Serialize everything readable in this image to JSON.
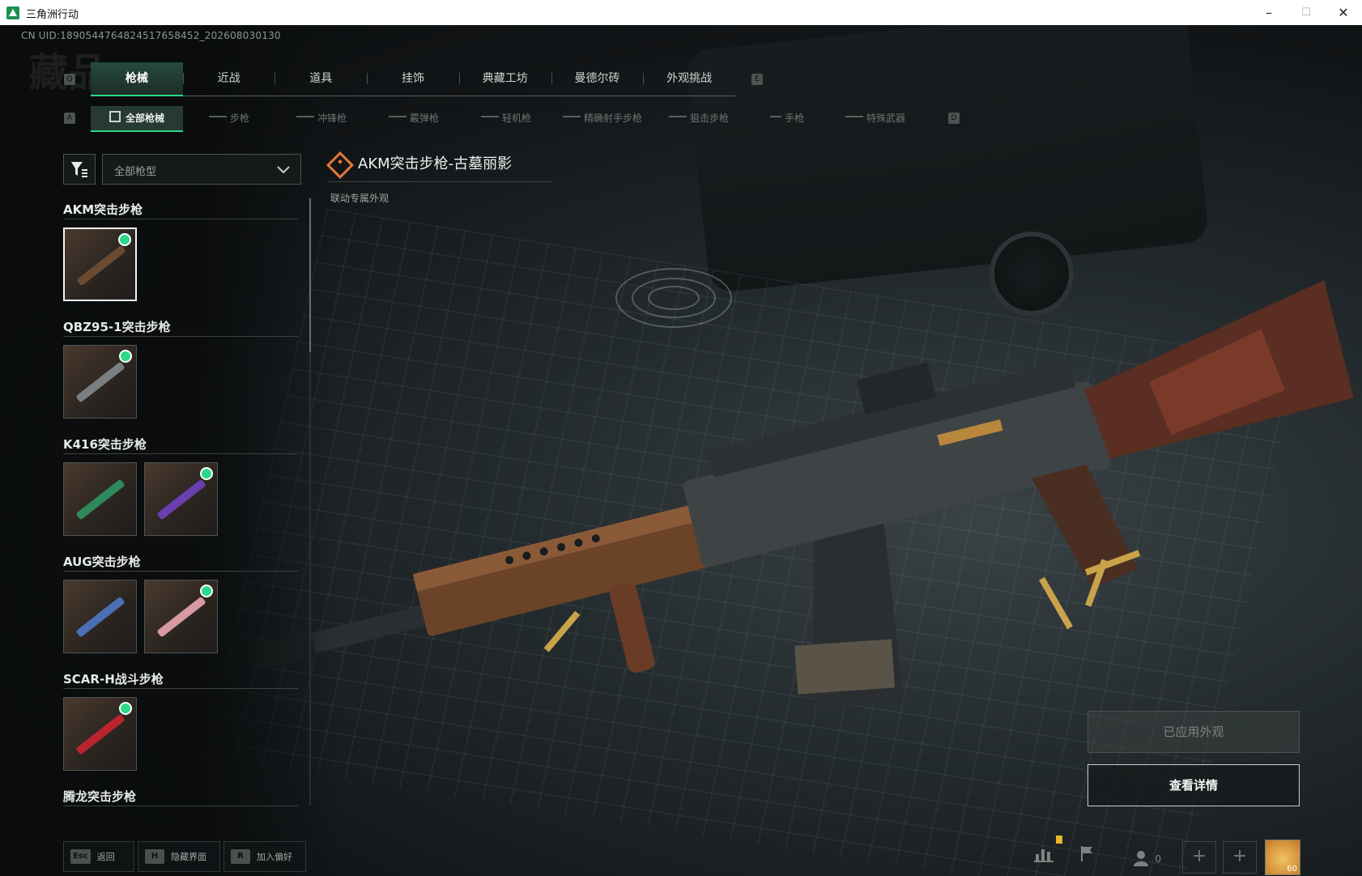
{
  "window": {
    "title": "三角洲行动",
    "minimize": "–",
    "maximize": "☐",
    "close": "✕"
  },
  "uid": "CN UID:1890544764824517658452_202608030130",
  "watermark": "藏品",
  "main_tabs": {
    "left_key": "Q",
    "right_key": "E",
    "items": [
      "枪械",
      "近战",
      "道具",
      "挂饰",
      "典藏工坊",
      "曼德尔砖",
      "外观挑战"
    ],
    "active_index": 0
  },
  "sub_tabs": {
    "left_key": "A",
    "right_key": "D",
    "items": [
      "全部枪械",
      "步枪",
      "冲锋枪",
      "霰弹枪",
      "轻机枪",
      "精确射手步枪",
      "狙击步枪",
      "手枪",
      "特殊武器"
    ],
    "active_index": 0
  },
  "filter": {
    "dropdown_value": "全部枪型"
  },
  "categories": [
    {
      "title": "AKM突击步枪",
      "skins": [
        {
          "color": "#6b4a30",
          "equipped": true,
          "selected": true
        }
      ]
    },
    {
      "title": "QBZ95-1突击步枪",
      "skins": [
        {
          "color": "#7a7f82",
          "equipped": true,
          "selected": false
        }
      ]
    },
    {
      "title": "K416突击步枪",
      "skins": [
        {
          "color": "#2e8a5a",
          "equipped": false,
          "selected": false
        },
        {
          "color": "#6a3fb0",
          "equipped": true,
          "selected": false
        }
      ]
    },
    {
      "title": "AUG突击步枪",
      "skins": [
        {
          "color": "#4a6fb5",
          "equipped": false,
          "selected": false
        },
        {
          "color": "#d79aa0",
          "equipped": true,
          "selected": false
        }
      ]
    },
    {
      "title": "SCAR-H战斗步枪",
      "skins": [
        {
          "color": "#b8242d",
          "equipped": true,
          "selected": false
        }
      ]
    },
    {
      "title": "腾龙突击步枪",
      "skins": []
    }
  ],
  "item": {
    "name": "AKM突击步枪-古墓丽影",
    "tag": "联动专属外观",
    "accent": "#e4783a"
  },
  "buttons": {
    "applied": "已应用外观",
    "detail": "查看详情"
  },
  "bottom_hints": [
    {
      "key": "Esc",
      "label": "返回"
    },
    {
      "key": "H",
      "label": "隐藏界面"
    },
    {
      "key": "R",
      "label": "加入偏好"
    }
  ],
  "bottom_right": {
    "friends_count": "0",
    "avatar_level": "60",
    "plus": "+"
  },
  "colors": {
    "accent_green": "#2bd989",
    "tab_active_bg": "#274b3c"
  }
}
